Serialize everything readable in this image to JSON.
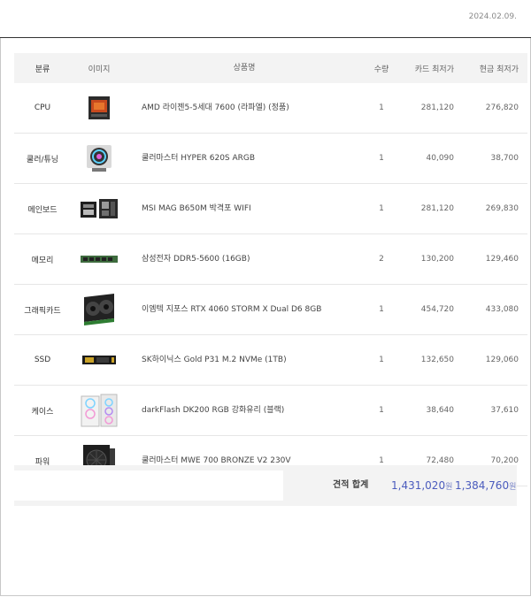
{
  "date": "2024.02.09.",
  "headers": {
    "category": "분류",
    "image": "이미지",
    "name": "상품명",
    "qty": "수량",
    "card": "카드 최저가",
    "cash": "현금 최저가"
  },
  "rows": [
    {
      "category": "CPU",
      "name": "AMD 라이젠5-5세대 7600 (라파엘) (정품)",
      "qty": "1",
      "card": "281,120",
      "cash": "276,820",
      "icon": "cpu-icon"
    },
    {
      "category": "쿨러/튜닝",
      "name": "쿨러마스터 HYPER 620S ARGB",
      "qty": "1",
      "card": "40,090",
      "cash": "38,700",
      "icon": "cooler-icon"
    },
    {
      "category": "메인보드",
      "name": "MSI MAG B650M 박격포 WIFI",
      "qty": "1",
      "card": "281,120",
      "cash": "269,830",
      "icon": "motherboard-icon"
    },
    {
      "category": "메모리",
      "name": "삼성전자 DDR5-5600 (16GB)",
      "qty": "2",
      "card": "130,200",
      "cash": "129,460",
      "icon": "memory-icon"
    },
    {
      "category": "그래픽카드",
      "name": "이엠텍 지포스 RTX 4060 STORM X Dual D6 8GB",
      "qty": "1",
      "card": "454,720",
      "cash": "433,080",
      "icon": "graphics-card-icon"
    },
    {
      "category": "SSD",
      "name": "SK하이닉스 Gold P31 M.2 NVMe (1TB)",
      "qty": "1",
      "card": "132,650",
      "cash": "129,060",
      "icon": "ssd-icon"
    },
    {
      "category": "케이스",
      "name": "darkFlash DK200 RGB 강화유리 (블랙)",
      "qty": "1",
      "card": "38,640",
      "cash": "37,610",
      "icon": "case-icon"
    },
    {
      "category": "파워",
      "name": "쿨러마스터 MWE 700 BRONZE V2 230V",
      "qty": "1",
      "card": "72,480",
      "cash": "70,200",
      "icon": "power-supply-icon"
    }
  ],
  "footer": {
    "label": "견적 합계",
    "total_card": "1,431,020",
    "total_cash": "1,384,760",
    "currency": "원"
  },
  "colors": {
    "accent": "#4a5bbd",
    "header_bg": "#f3f3f3"
  }
}
